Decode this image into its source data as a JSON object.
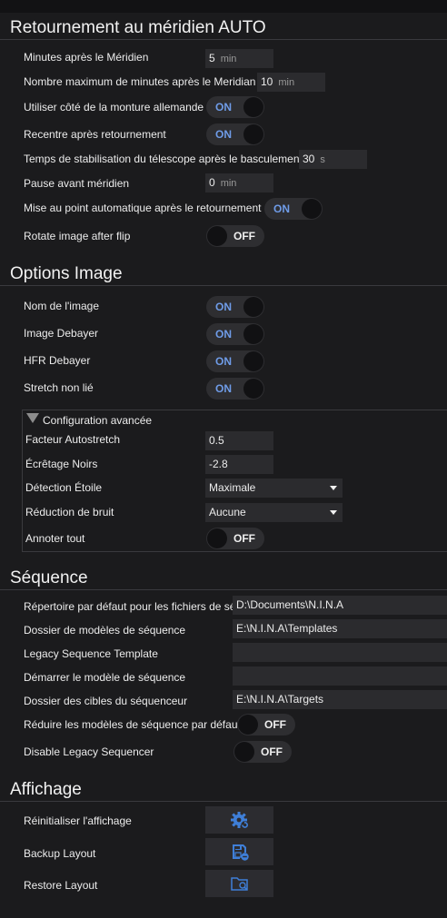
{
  "sections": {
    "meridian": {
      "title": "Retournement au méridien AUTO",
      "minutes_after_label": "Minutes après le Méridien",
      "minutes_after_value": "5",
      "max_minutes_label": "Nombre maximum de minutes après le Meridian",
      "max_minutes_value": "10",
      "use_side_label": "Utiliser côté de la monture allemande",
      "use_side_state": "ON",
      "recenter_label": "Recentre après retournement",
      "recenter_state": "ON",
      "settle_label": "Temps de stabilisation du télescope après le basculement",
      "settle_value": "30",
      "pause_label": "Pause avant méridien",
      "pause_value": "0",
      "autofocus_label": "Mise au point automatique après le retournement",
      "autofocus_state": "ON",
      "rotate_label": "Rotate image after flip",
      "rotate_state": "OFF"
    },
    "image": {
      "title": "Options Image",
      "name_label": "Nom de l'image",
      "name_state": "ON",
      "debayer_label": "Image Debayer",
      "debayer_state": "ON",
      "hfr_label": "HFR Debayer",
      "hfr_state": "ON",
      "stretch_label": "Stretch non lié",
      "stretch_state": "ON",
      "advanced_label": "Configuration avancée",
      "autostretch_label": "Facteur Autostretch",
      "autostretch_value": "0.5",
      "blackclip_label": "Écrêtage Noirs",
      "blackclip_value": "-2.8",
      "star_label": "Détection Étoile",
      "star_value": "Maximale",
      "noise_label": "Réduction de bruit",
      "noise_value": "Aucune",
      "annotate_label": "Annoter tout",
      "annotate_state": "OFF"
    },
    "sequence": {
      "title": "Séquence",
      "default_dir_label": "Répertoire par défaut pour les fichiers de sé",
      "default_dir_value": "D:\\Documents\\N.I.N.A",
      "templates_label": "Dossier de modèles de séquence",
      "templates_value": "E:\\N.I.N.A\\Templates",
      "legacy_template_label": "Legacy Sequence Template",
      "legacy_template_value": "",
      "start_template_label": "Démarrer le modèle de séquence",
      "start_template_value": "",
      "targets_label": "Dossier des cibles du séquenceur",
      "targets_value": "E:\\N.I.N.A\\Targets",
      "collapse_label": "Réduire les modèles de séquence par défaut",
      "collapse_state": "OFF",
      "disable_legacy_label": "Disable Legacy Sequencer",
      "disable_legacy_state": "OFF"
    },
    "display": {
      "title": "Affichage",
      "reset_label": "Réinitialiser l'affichage",
      "backup_label": "Backup Layout",
      "restore_label": "Restore Layout"
    }
  },
  "units": {
    "min": "min",
    "s": "s"
  },
  "colors": {
    "background": "#1b1b1d",
    "field": "#2b2b2e",
    "on_text": "#6f9ce8",
    "icon": "#3f7fd8"
  },
  "icons": [
    "gear-refresh-icon",
    "save-layout-icon",
    "folder-search-icon",
    "expander-triangle-icon",
    "dropdown-arrow-icon"
  ]
}
